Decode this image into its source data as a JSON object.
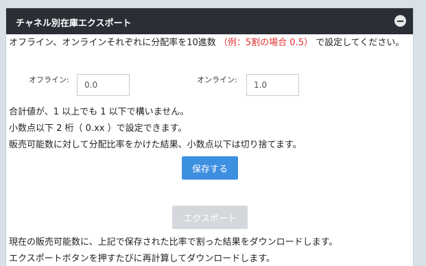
{
  "panel": {
    "title": "チャネル別在庫エクスポート",
    "collapse_icon": "minus-circle-icon"
  },
  "instructions": {
    "intro_before": "オフライン、オンラインそれぞれに分配率を10進数",
    "intro_example": "（例：5割の場合 0.5）",
    "intro_after": "で設定してください。"
  },
  "fields": {
    "offline": {
      "label": "オフライン:",
      "value": "0.0"
    },
    "online": {
      "label": "オンライン:",
      "value": "1.0"
    }
  },
  "notes": [
    "合計値が、1 以上でも 1 以下で構いません。",
    "小数点以下 2 桁（ 0.xx ）で設定できます。",
    "販売可能数に対して分配比率をかけた結果、小数点以下は切り捨てます。"
  ],
  "buttons": {
    "save_label": "保存する",
    "export_label": "エクスポート"
  },
  "export_notes": [
    "現在の販売可能数に、上記で保存された比率で割った結果をダウンロードします。",
    "エクスポートボタンを押すたびに再計算してダウンロードします。"
  ],
  "colors": {
    "header_bg": "#2a2f36",
    "primary_button": "#3d8fe0",
    "disabled_button": "#d4d8dc",
    "example_text": "#e03030"
  }
}
